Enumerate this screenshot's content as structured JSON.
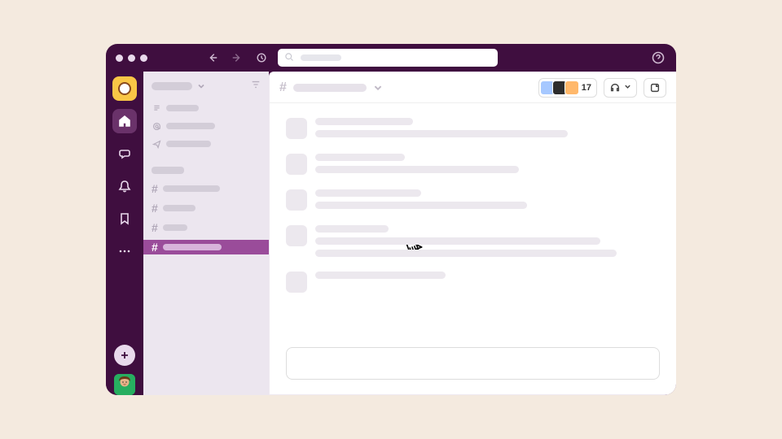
{
  "titlebar": {
    "search_placeholder": ""
  },
  "rail": {
    "items": [
      "workspace",
      "home",
      "dms",
      "activity",
      "later",
      "more"
    ]
  },
  "sidebar": {
    "header_label": "",
    "nav": [
      {
        "icon": "threads",
        "label": ""
      },
      {
        "icon": "mentions",
        "label": ""
      },
      {
        "icon": "drafts",
        "label": ""
      }
    ],
    "section_label": "",
    "channels": [
      {
        "label": "",
        "selected": false,
        "width": 70
      },
      {
        "label": "",
        "selected": false,
        "width": 40
      },
      {
        "label": "",
        "selected": false,
        "width": 30
      },
      {
        "label": "",
        "selected": true,
        "width": 72
      }
    ]
  },
  "channel_header": {
    "name": "",
    "member_count": "17"
  },
  "messages": [
    {
      "lines": [
        120,
        310
      ]
    },
    {
      "lines": [
        110,
        250
      ]
    },
    {
      "lines": [
        130,
        260
      ]
    },
    {
      "lines": [
        90,
        350,
        370
      ]
    },
    {
      "lines": [
        160
      ]
    }
  ],
  "composer": {
    "placeholder": ""
  }
}
